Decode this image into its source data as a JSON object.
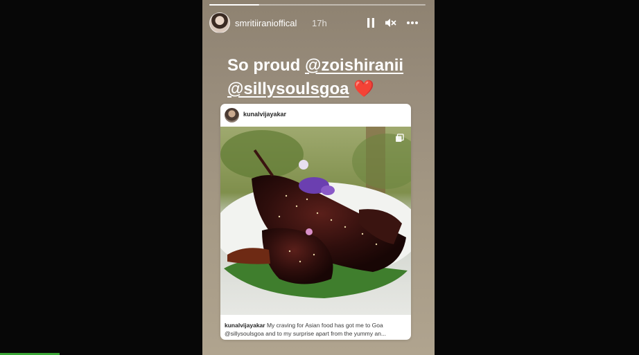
{
  "story": {
    "username": "smritiiranioffical",
    "time": "17h",
    "progress": 0.23,
    "caption_prefix": "So proud ",
    "mention_1": "@zoishiranii",
    "mention_2": "@sillysoulsgoa",
    "heart": "❤️"
  },
  "controls": {
    "pause_icon": "pause-icon",
    "mute_icon": "muted-speaker-icon",
    "more_icon": "more-options-icon"
  },
  "post": {
    "username": "kunalvijayakar",
    "caption_user": "kunalvijayakar",
    "caption_text": " My craving for Asian food has got me to Goa @sillysoulsgoa and to my surprise apart from the yummy an...",
    "multi_image_icon": "multiple-images-icon"
  },
  "colors": {
    "background": "#070707",
    "heart": "#e5201f",
    "bottom_bar": "#3aa535"
  }
}
